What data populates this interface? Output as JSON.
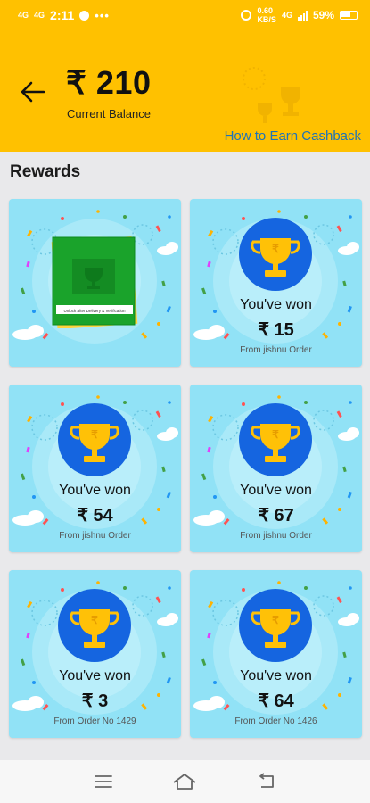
{
  "status_bar": {
    "left_tag_1": "4G",
    "left_tag_2": "4G",
    "time": "2:11",
    "more": "•••",
    "speed": "0.60",
    "speed_unit": "KB/S",
    "net": "4G",
    "battery": "59%"
  },
  "header": {
    "back_icon": "arrow-left-icon",
    "balance": "₹ 210",
    "balance_label": "Current Balance",
    "earn_link": "How to Earn Cashback",
    "background_color": "#ffc100"
  },
  "section_title": "Rewards",
  "cards": [
    {
      "type": "scratch",
      "scratch_text": "Unlock after Delivery & Verification"
    },
    {
      "type": "won",
      "won_label": "You've won",
      "amount": "₹ 15",
      "from": "From  jishnu Order"
    },
    {
      "type": "won",
      "won_label": "You've won",
      "amount": "₹ 54",
      "from": "From  jishnu Order"
    },
    {
      "type": "won",
      "won_label": "You've won",
      "amount": "₹ 67",
      "from": "From  jishnu Order"
    },
    {
      "type": "won",
      "won_label": "You've won",
      "amount": "₹ 3",
      "from": "From Order No 1429"
    },
    {
      "type": "won",
      "won_label": "You've won",
      "amount": "₹ 64",
      "from": "From Order No 1426"
    }
  ],
  "bottom_nav": {
    "menu_icon": "hamburger-menu-icon",
    "home_icon": "home-icon",
    "back_icon": "back-return-icon"
  },
  "colors": {
    "accent": "#ffc100",
    "card_bg": "#91e2f6",
    "trophy_circle": "#1565e0",
    "trophy": "#ffc107",
    "link": "#1f73b7",
    "scratch_green": "#1aa32b"
  }
}
